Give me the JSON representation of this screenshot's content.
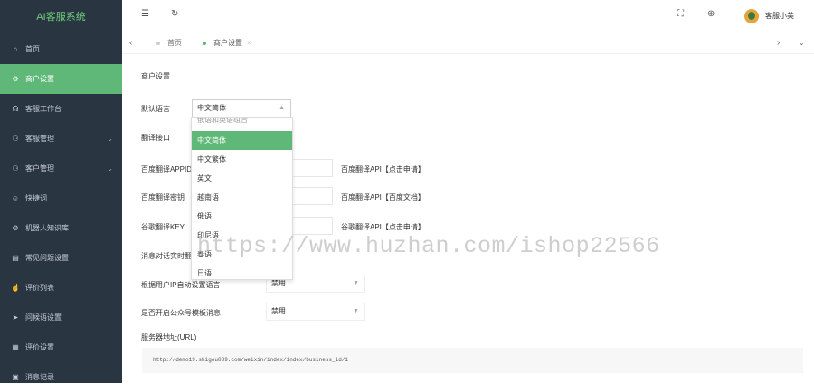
{
  "app": {
    "logo": "AI客服系统"
  },
  "sidebar": {
    "items": [
      {
        "label": "首页",
        "icon": "home-icon",
        "glyph": "⌂"
      },
      {
        "label": "商户设置",
        "icon": "gear-icon",
        "glyph": "⚙"
      },
      {
        "label": "客服工作台",
        "icon": "headset-icon",
        "glyph": "☊"
      },
      {
        "label": "客服管理",
        "icon": "user-icon",
        "glyph": "⚇"
      },
      {
        "label": "客户管理",
        "icon": "users-icon",
        "glyph": "⚇"
      },
      {
        "label": "快捷词",
        "icon": "smile-icon",
        "glyph": "☺"
      },
      {
        "label": "机器人知识库",
        "icon": "robot-icon",
        "glyph": "⚙"
      },
      {
        "label": "常见问题设置",
        "icon": "document-icon",
        "glyph": "▤"
      },
      {
        "label": "评价列表",
        "icon": "thumb-icon",
        "glyph": "☝"
      },
      {
        "label": "问候语设置",
        "icon": "send-icon",
        "glyph": "➤"
      },
      {
        "label": "评价设置",
        "icon": "calendar-icon",
        "glyph": "▦"
      },
      {
        "label": "消息记录",
        "icon": "message-icon",
        "glyph": "▣"
      }
    ]
  },
  "topbar": {
    "user_name": "客服小美"
  },
  "tabs": [
    {
      "label": "首页"
    },
    {
      "label": "商户设置",
      "close": "×"
    }
  ],
  "form": {
    "section_title": "商户设置",
    "default_lang_label": "默认语言",
    "default_lang_value": "中文简体",
    "translate_api_label": "翻译接口",
    "baidu_appid_label": "百度翻译APPID",
    "baidu_appid_link": "百度翻译API【点击申请】",
    "baidu_key_label": "百度翻译密钥",
    "baidu_key_link": "百度翻译API【百度文档】",
    "gugu_key_label": "谷歌翻译KEY",
    "gugu_key_link": "谷歌翻译API【点击申请】",
    "auto_translate_label": "消息对话实时翻",
    "ip_lang_label": "根据用户IP自动设置语言",
    "ip_lang_value": "禁用",
    "wechat_label": "是否开启公众号模板消息",
    "wechat_value": "禁用",
    "server_url_label": "服务器地址(URL)",
    "server_url_value": "http://demo19.shigou889.com/weixin/index/index/business_id/1"
  },
  "dropdown": {
    "partial_top": "俄语和英语组合",
    "options": [
      "中文简体",
      "中文繁体",
      "英文",
      "越南语",
      "俄语",
      "印尼语",
      "泰语",
      "日语"
    ],
    "selected_index": 0
  },
  "watermark": "https://www.huzhan.com/ishop22566",
  "colors": {
    "accent": "#5fb878",
    "sidebar_bg": "#2a3542",
    "logo": "#6fce7c"
  }
}
